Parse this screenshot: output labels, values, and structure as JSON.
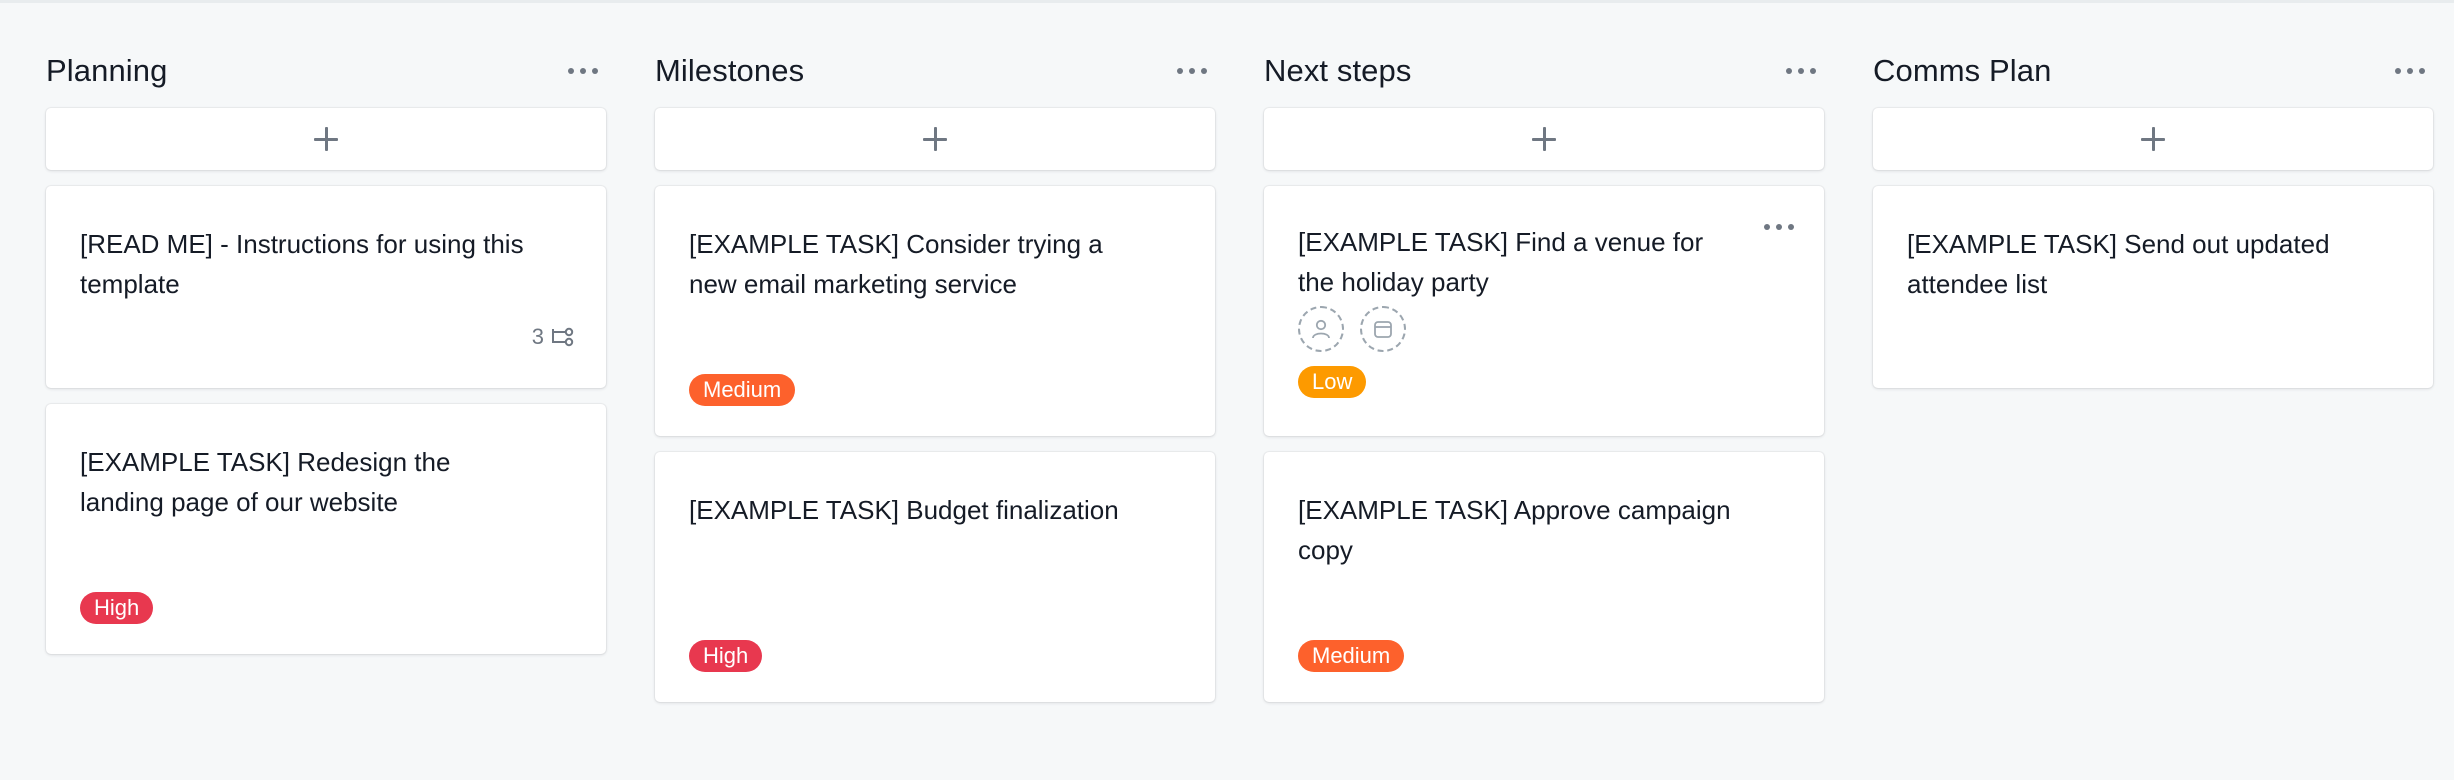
{
  "board": {
    "columns": [
      {
        "title": "Planning",
        "cards": [
          {
            "title": "[READ ME] - Instructions for using this template",
            "subtask_count": "3"
          },
          {
            "title": "[EXAMPLE TASK] Redesign the landing page of our website",
            "tag": "High"
          }
        ]
      },
      {
        "title": "Milestones",
        "cards": [
          {
            "title": "[EXAMPLE TASK] Consider trying a new email marketing service",
            "tag": "Medium"
          },
          {
            "title": "[EXAMPLE TASK] Budget finalization",
            "tag": "High"
          }
        ]
      },
      {
        "title": "Next steps",
        "cards": [
          {
            "title": "[EXAMPLE TASK] Find a venue for the holiday party",
            "tag": "Low"
          },
          {
            "title": "[EXAMPLE TASK] Approve campaign copy",
            "tag": "Medium"
          }
        ]
      },
      {
        "title": "Comms Plan",
        "cards": [
          {
            "title": "[EXAMPLE TASK] Send out updated attendee list"
          }
        ]
      }
    ]
  },
  "colors": {
    "high": "#e8384f",
    "medium": "#fd612c",
    "low": "#fd9a00",
    "icon": "#6f7782"
  },
  "icons": [
    "more-icon",
    "plus-icon",
    "subtask-icon",
    "assignee-icon",
    "due-date-icon"
  ]
}
